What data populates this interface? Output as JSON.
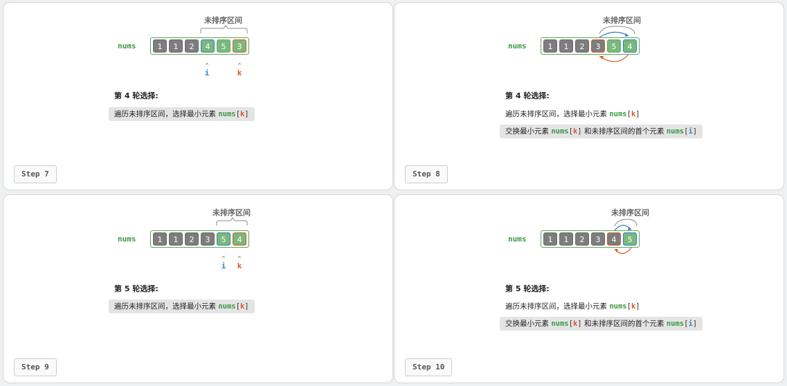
{
  "labels": {
    "nums": "nums",
    "unsorted_region": "未排序区间",
    "i": "i",
    "k": "k",
    "caret": "^"
  },
  "colors": {
    "sorted": "#7d7d7d",
    "unsorted": "#7ab87c",
    "i_pointer": "#2f7fbf",
    "k_pointer": "#d85a2a",
    "code_green": "#3e9a45"
  },
  "panels": [
    {
      "step": "Step 7",
      "round_title": "第 4 轮选择:",
      "array": [
        "1",
        "1",
        "2",
        "4",
        "5",
        "3"
      ],
      "line1": {
        "text": "遍历未排序区间，选择最小元素 ",
        "code_name": "nums",
        "lb": "[",
        "idx": "k",
        "rb": "]"
      }
    },
    {
      "step": "Step 8",
      "round_title": "第 4 轮选择:",
      "array": [
        "1",
        "1",
        "2",
        "3",
        "5",
        "4"
      ],
      "line1": {
        "text": "遍历未排序区间，选择最小元素 ",
        "code_name": "nums",
        "lb": "[",
        "idx": "k",
        "rb": "]"
      },
      "line2": {
        "pre": "交换最小元素 ",
        "code_name": "nums",
        "lb": "[",
        "idx_k": "k",
        "rb": "]",
        "mid": " 和未排序区间的首个元素 ",
        "idx_i": "i"
      }
    },
    {
      "step": "Step 9",
      "round_title": "第 5 轮选择:",
      "array": [
        "1",
        "1",
        "2",
        "3",
        "5",
        "4"
      ],
      "line1": {
        "text": "遍历未排序区间，选择最小元素 ",
        "code_name": "nums",
        "lb": "[",
        "idx": "k",
        "rb": "]"
      }
    },
    {
      "step": "Step 10",
      "round_title": "第 5 轮选择:",
      "array": [
        "1",
        "1",
        "2",
        "3",
        "4",
        "5"
      ],
      "line1": {
        "text": "遍历未排序区间，选择最小元素 ",
        "code_name": "nums",
        "lb": "[",
        "idx": "k",
        "rb": "]"
      },
      "line2": {
        "pre": "交换最小元素 ",
        "code_name": "nums",
        "lb": "[",
        "idx_k": "k",
        "rb": "]",
        "mid": " 和未排序区间的首个元素 ",
        "idx_i": "i"
      }
    }
  ]
}
